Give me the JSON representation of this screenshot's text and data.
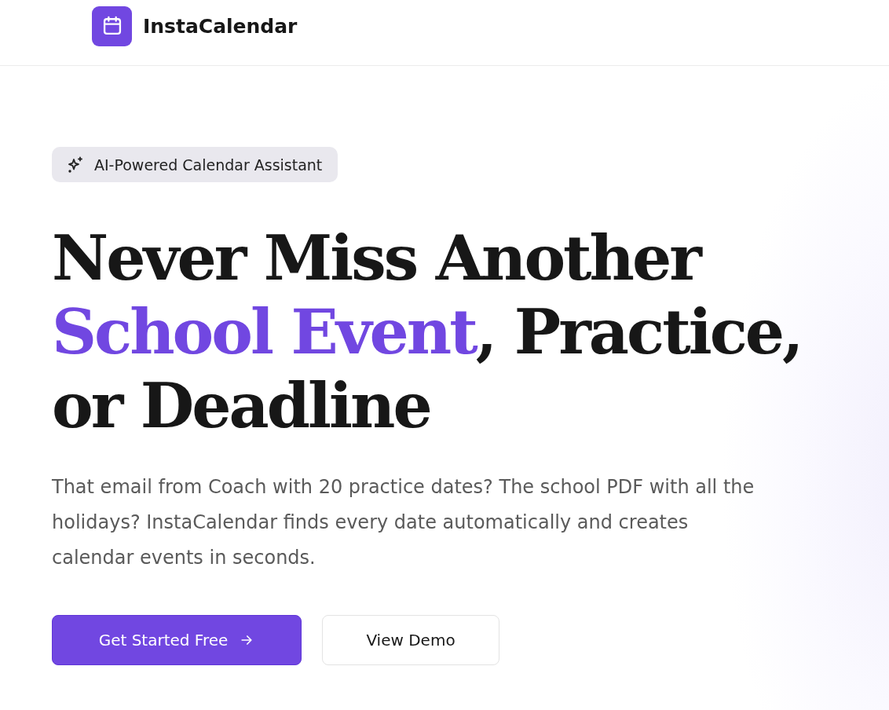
{
  "brand": {
    "name": "InstaCalendar"
  },
  "badge": {
    "label": "AI-Powered Calendar Assistant"
  },
  "headline": [
    [
      {
        "text": "Never Miss Another",
        "highlight": false
      }
    ],
    [
      {
        "text": "School Event",
        "highlight": true
      },
      {
        "text": ", Practice,",
        "highlight": false
      }
    ],
    [
      {
        "text": "or Deadline",
        "highlight": false
      }
    ]
  ],
  "description": "That email from Coach with 20 practice dates? The school PDF with all the holidays? InstaCalendar finds every date automatically and creates calendar events in seconds.",
  "buttons": [
    {
      "label": "Get Started Free",
      "kind": "primary"
    },
    {
      "label": "View Demo",
      "kind": "secondary"
    }
  ]
}
